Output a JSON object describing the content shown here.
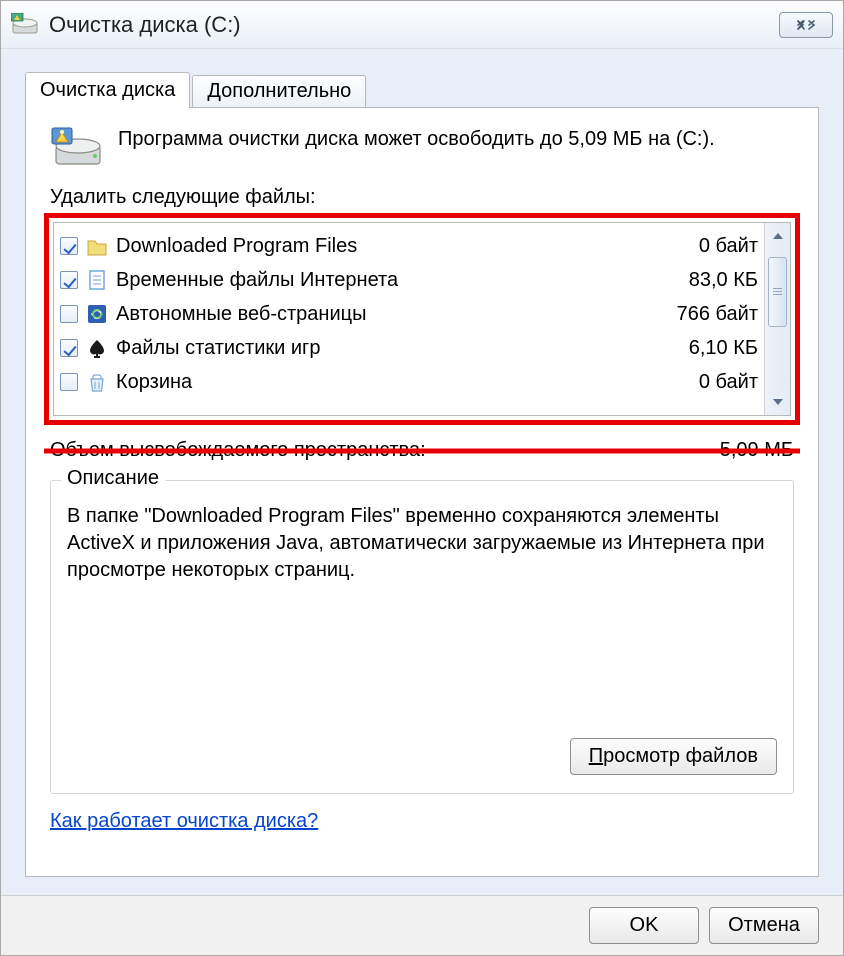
{
  "window": {
    "title": "Очистка диска  (C:)"
  },
  "tabs": [
    {
      "label": "Очистка диска",
      "active": true
    },
    {
      "label": "Дополнительно",
      "active": false
    }
  ],
  "summary": "Программа очистки диска может освободить до 5,09 МБ на  (C:).",
  "section_label": "Удалить следующие файлы:",
  "files": [
    {
      "checked": true,
      "icon": "folder",
      "label": "Downloaded Program Files",
      "size": "0 байт"
    },
    {
      "checked": true,
      "icon": "page",
      "label": "Временные файлы Интернета",
      "size": "83,0 КБ"
    },
    {
      "checked": false,
      "icon": "refresh",
      "label": "Автономные веб-страницы",
      "size": "766 байт"
    },
    {
      "checked": true,
      "icon": "spade",
      "label": "Файлы статистики игр",
      "size": "6,10 КБ"
    },
    {
      "checked": false,
      "icon": "recycle",
      "label": "Корзина",
      "size": "0 байт"
    }
  ],
  "total": {
    "label": "Объем высвобождаемого пространства:",
    "value": "5,09 МБ"
  },
  "description": {
    "legend": "Описание",
    "text": "В папке \"Downloaded Program Files\" временно сохраняются элементы ActiveX и приложения Java, автоматически загружаемые из Интернета при просмотре некоторых страниц."
  },
  "buttons": {
    "view_files": "Просмотр файлов",
    "ok": "OK",
    "cancel": "Отмена"
  },
  "help_link": "Как работает очистка диска?"
}
